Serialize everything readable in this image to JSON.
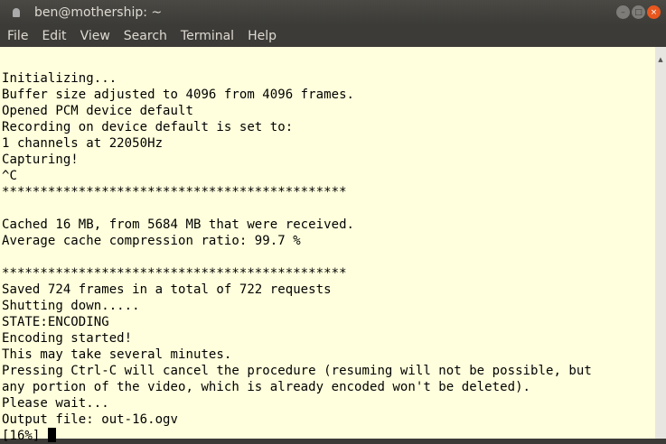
{
  "window": {
    "title": "ben@mothership: ~"
  },
  "menu": [
    "File",
    "Edit",
    "View",
    "Search",
    "Terminal",
    "Help"
  ],
  "terminal": {
    "lines": [
      "",
      "Initializing...",
      "Buffer size adjusted to 4096 from 4096 frames.",
      "Opened PCM device default",
      "Recording on device default is set to:",
      "1 channels at 22050Hz",
      "Capturing!",
      "^C",
      "*********************************************",
      "",
      "Cached 16 MB, from 5684 MB that were received.",
      "Average cache compression ratio: 99.7 %",
      "",
      "*********************************************",
      "Saved 724 frames in a total of 722 requests",
      "Shutting down.....",
      "STATE:ENCODING",
      "Encoding started!",
      "This may take several minutes.",
      "Pressing Ctrl-C will cancel the procedure (resuming will not be possible, but",
      "any portion of the video, which is already encoded won't be deleted).",
      "Please wait...",
      "Output file: out-16.ogv"
    ],
    "prompt": "[16%] "
  }
}
